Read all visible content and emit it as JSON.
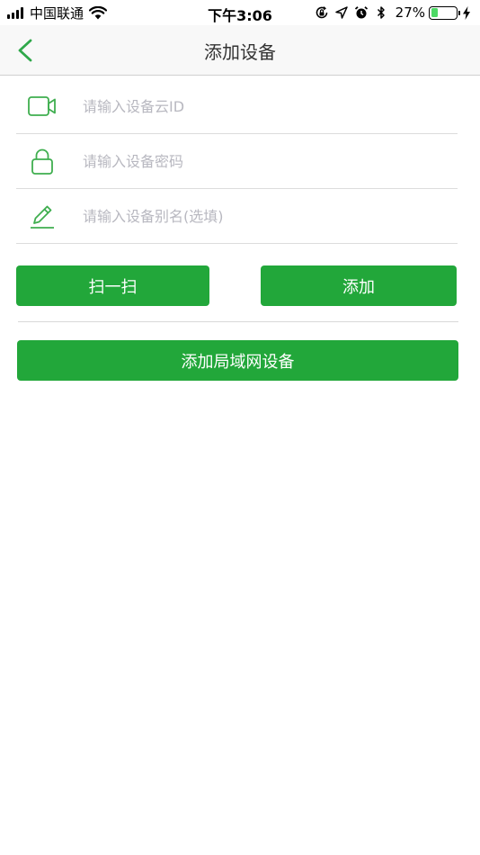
{
  "status_bar": {
    "carrier": "中国联通",
    "time": "下午3:06",
    "battery_percent": "27%",
    "battery_level": 0.27,
    "icons": [
      "signal-icon",
      "wifi-icon",
      "orientation-lock-icon",
      "location-icon",
      "alarm-icon",
      "bluetooth-icon",
      "battery-icon",
      "charging-icon"
    ]
  },
  "nav": {
    "title": "添加设备",
    "back_icon": "chevron-left-icon"
  },
  "form": {
    "cloud_id": {
      "placeholder": "请输入设备云ID",
      "value": "",
      "icon": "video-camera-icon"
    },
    "password": {
      "placeholder": "请输入设备密码",
      "value": "",
      "icon": "lock-icon"
    },
    "alias": {
      "placeholder": "请输入设备别名(选填)",
      "value": "",
      "icon": "pencil-icon"
    }
  },
  "buttons": {
    "scan_label": "扫一扫",
    "add_label": "添加",
    "lan_label": "添加局域网设备"
  },
  "colors": {
    "accent": "#22a73a",
    "icon_green": "#3fae4f",
    "placeholder": "#b8b8c0"
  }
}
